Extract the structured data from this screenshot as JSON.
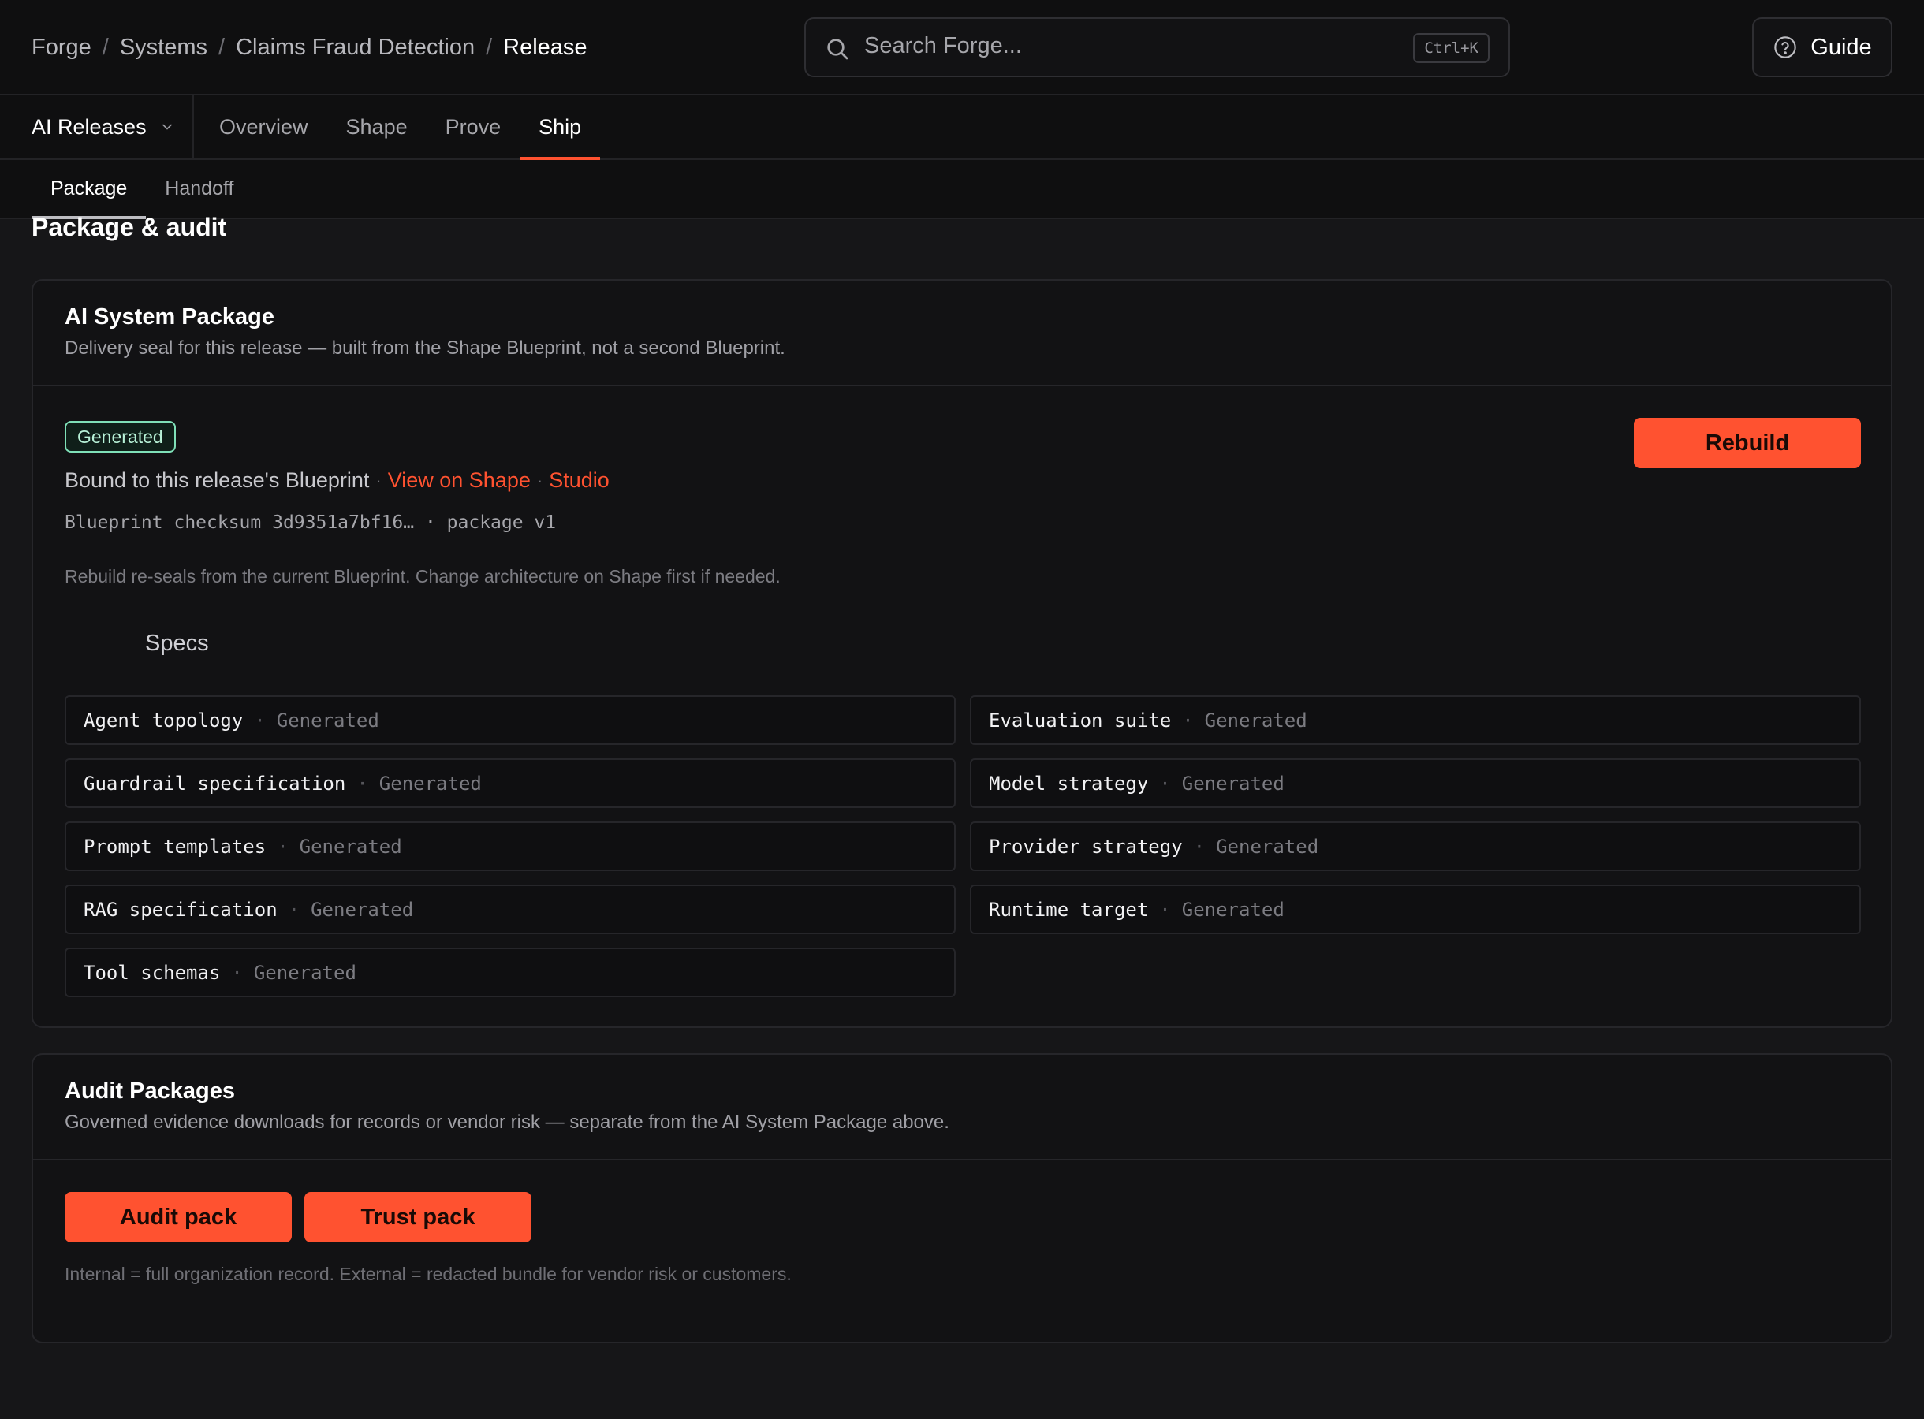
{
  "breadcrumb": {
    "items": [
      "Forge",
      "Systems",
      "Claims Fraud Detection"
    ],
    "current": "Release",
    "separator": "/"
  },
  "search": {
    "placeholder": "Search Forge...",
    "shortcut": "Ctrl+K"
  },
  "guide": {
    "label": "Guide",
    "icon": "help-circle-icon"
  },
  "product_switcher": {
    "label": "AI Releases",
    "icon": "chevron-down-icon"
  },
  "nav": {
    "tabs": [
      {
        "label": "Overview",
        "active": false
      },
      {
        "label": "Shape",
        "active": false
      },
      {
        "label": "Prove",
        "active": false
      },
      {
        "label": "Ship",
        "active": true
      }
    ]
  },
  "subnav": {
    "tabs": [
      {
        "label": "Package",
        "active": true
      },
      {
        "label": "Handoff",
        "active": false
      }
    ]
  },
  "page": {
    "title": "Package & audit"
  },
  "package_card": {
    "title": "AI System Package",
    "description": "Delivery seal for this release — built from the Shape Blueprint, not a second Blueprint.",
    "status_badge": "Generated",
    "bound_text": "Bound to this release's Blueprint",
    "dot": "·",
    "link_view_on_shape": "View on Shape",
    "link_studio": "Studio",
    "checksum": "Blueprint checksum 3d9351a7bf16… · package v1",
    "rebuild_label": "Rebuild",
    "rebuild_note": "Rebuild re-seals from the current Blueprint. Change architecture on Shape first if needed.",
    "specs_title": "Specs",
    "specs": [
      {
        "name": "Agent topology",
        "status": "Generated"
      },
      {
        "name": "Evaluation suite",
        "status": "Generated"
      },
      {
        "name": "Guardrail specification",
        "status": "Generated"
      },
      {
        "name": "Model strategy",
        "status": "Generated"
      },
      {
        "name": "Prompt templates",
        "status": "Generated"
      },
      {
        "name": "Provider strategy",
        "status": "Generated"
      },
      {
        "name": "RAG specification",
        "status": "Generated"
      },
      {
        "name": "Runtime target",
        "status": "Generated"
      },
      {
        "name": "Tool schemas",
        "status": "Generated"
      }
    ]
  },
  "audit_card": {
    "title": "Audit Packages",
    "description": "Governed evidence downloads for records or vendor risk — separate from the AI System Package above.",
    "audit_pack_label": "Audit pack",
    "trust_pack_label": "Trust pack",
    "note": "Internal = full organization record. External = redacted bundle for vendor risk or customers."
  },
  "colors": {
    "accent": "#ff5230",
    "background": "#161618",
    "card": "#121214",
    "badge_border": "#7fe0b8"
  }
}
